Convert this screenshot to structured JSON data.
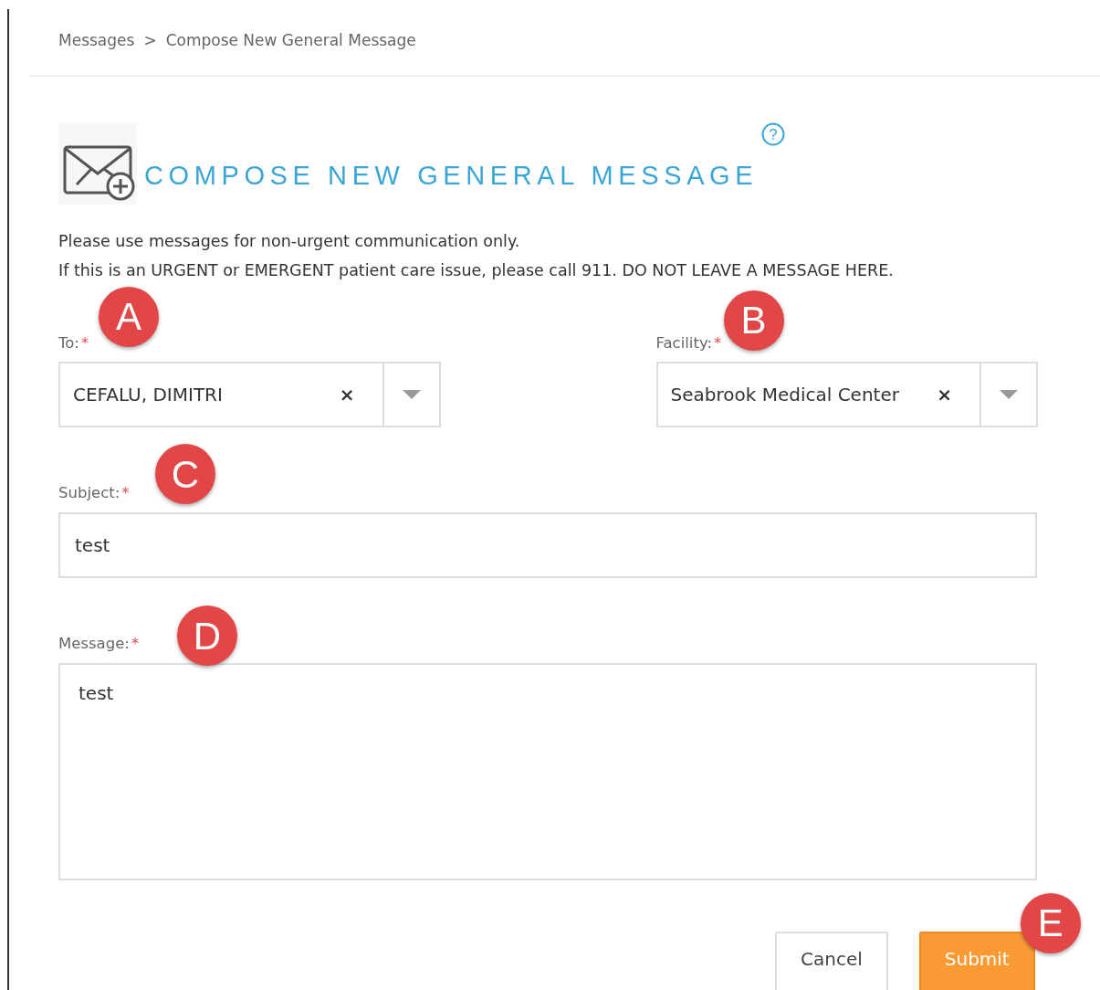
{
  "breadcrumb": {
    "items": [
      "Messages",
      "Compose New General Message"
    ],
    "separator": ">"
  },
  "title": "COMPOSE NEW GENERAL MESSAGE",
  "help": "?",
  "notice": [
    "Please use messages for non-urgent communication only.",
    "If this is an URGENT or EMERGENT patient care issue, please call 911. DO NOT LEAVE A MESSAGE HERE."
  ],
  "fields": [
    {
      "kind": "select",
      "label": "To:",
      "required_mark": "*",
      "value": "CEFALU, DIMITRI",
      "clear": "×",
      "callout": "A"
    },
    {
      "kind": "select",
      "label": "Facility:",
      "required_mark": "*",
      "value": "Seabrook Medical Center",
      "clear": "×",
      "callout": "B"
    },
    {
      "kind": "text",
      "label": "Subject:",
      "required_mark": "*",
      "value": "test",
      "callout": "C"
    },
    {
      "kind": "textarea",
      "label": "Message:",
      "required_mark": "*",
      "value": "test",
      "callout": "D"
    }
  ],
  "buttons": [
    {
      "kind": "secondary",
      "label": "Cancel"
    },
    {
      "kind": "primary",
      "label": "Submit",
      "callout": "E"
    }
  ]
}
